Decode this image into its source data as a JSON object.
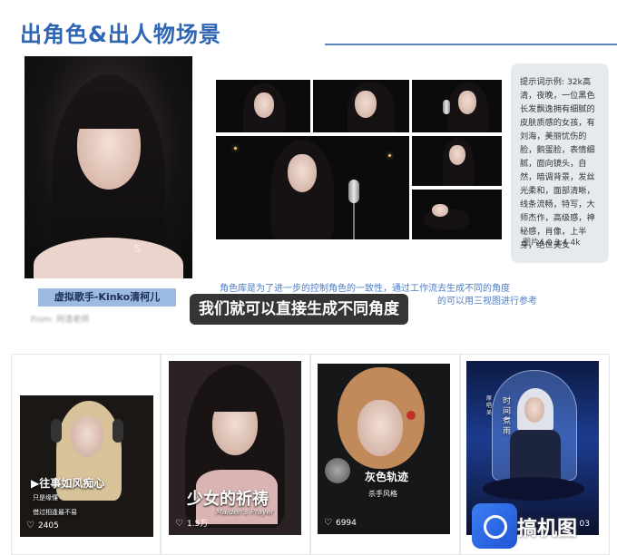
{
  "slide": {
    "title": "出角色&出人物场景",
    "portrait_caption": "虚拟歌手-Kinko清柯儿",
    "from_label": "From: 阿清老师",
    "watermark": "S",
    "prompt_text": "提示词示例: 32k高清，夜晚，一位黑色长发飘逸拥有细腻的皮肤质感的女孩，有刘海，美丽忧伤的脸，鹅蛋脸，表情细腻，面向镜头，自然，暗调背景，发丝光柔和，面部清晰，线条流畅，特写，大师杰作，高级感，神秘感，肖像，上半身，绝世美女",
    "prompt_meta": "图片4.0 3:4 4k",
    "note_line1": "角色库是为了进一步的控制角色的一致性，通过工作流去生成不同的角度",
    "note_line2": "的可以用三视图进行参考"
  },
  "video_subtitle": "我们就可以直接生成不同角度",
  "feed": {
    "cards": [
      {
        "overlay_title": "▶往事如风痴心",
        "overlay_sub1": "只是缘懂",
        "overlay_sub2": "借过相逢最不易",
        "likes": "2405"
      },
      {
        "overlay_title": "少女的祈祷",
        "overlay_sub1": "Maiden's Prayer",
        "likes": "1.5万"
      },
      {
        "overlay_title": "灰色轨迹",
        "overlay_sub1": "杀手风格",
        "likes": "6994"
      },
      {
        "overlay_title": "时间煮雨",
        "overlay_sub1": "原唱·吴",
        "likes": "03"
      }
    ]
  },
  "badge": {
    "text": "搞机图"
  },
  "colors": {
    "accent": "#2f66b3",
    "note": "#4d7cc4",
    "caption_bg": "#9dbbe2"
  }
}
